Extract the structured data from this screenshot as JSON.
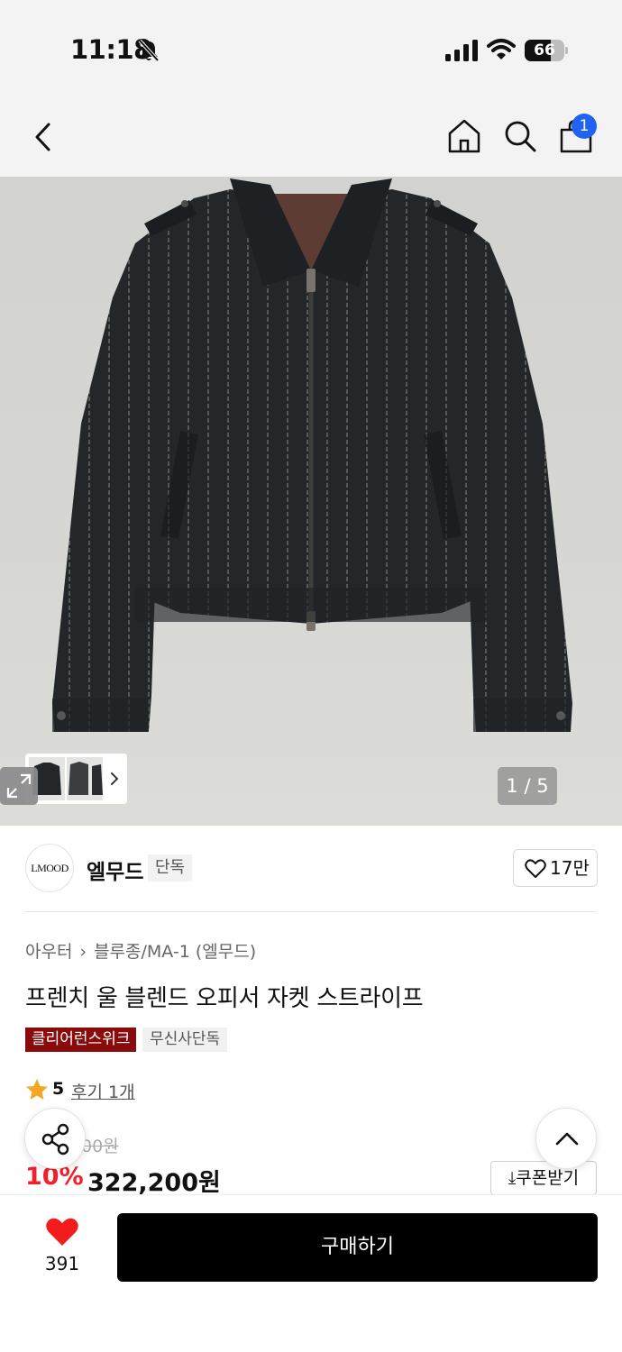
{
  "status_bar": {
    "time": "11:18",
    "battery": "66",
    "battery_level": 0.66,
    "icons": [
      "bell-off-icon",
      "signal-icon",
      "wifi-icon",
      "battery-icon"
    ]
  },
  "nav": {
    "cart_count": "1",
    "icons": [
      "back-icon",
      "home-icon",
      "search-icon",
      "cart-icon"
    ]
  },
  "gallery": {
    "counter": "1 / 5",
    "icons": [
      "chevron-right-icon",
      "expand-icon"
    ]
  },
  "brand": {
    "logo": "LMOOD",
    "name": "엘무드",
    "tag": "단독",
    "likes": "17만"
  },
  "product": {
    "breadcrumb": [
      "아우터",
      "블루종/MA-1 (엘무드)"
    ],
    "title": "프렌치 울 블렌드 오피서 자켓 스트라이프",
    "badges": [
      "클리어런스위크",
      "무신사단독"
    ],
    "rating": "5",
    "review_link": "후기 1개",
    "original_price_partial": "00원",
    "discount": "10%",
    "price": "322,200원",
    "coupon_label": "쿠폰받기"
  },
  "bottom_bar": {
    "wish_count": "391",
    "buy_label": "구매하기"
  },
  "colors": {
    "accent_blue": "#1f63f0",
    "sale_red": "#f2202a",
    "badge_red": "#8a0b0b",
    "wish_red": "#f21c1c",
    "buy_black": "#000000"
  }
}
